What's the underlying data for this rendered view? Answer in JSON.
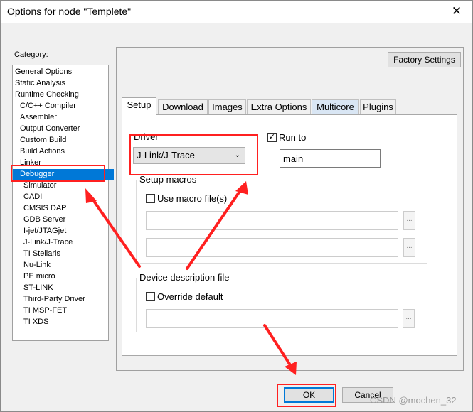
{
  "window": {
    "title": "Options for node \"Templete\"",
    "close_glyph": "✕"
  },
  "category": {
    "label": "Category:",
    "items": [
      {
        "label": "General Options",
        "indent": 0
      },
      {
        "label": "Static Analysis",
        "indent": 0
      },
      {
        "label": "Runtime Checking",
        "indent": 0
      },
      {
        "label": "C/C++ Compiler",
        "indent": 1
      },
      {
        "label": "Assembler",
        "indent": 1
      },
      {
        "label": "Output Converter",
        "indent": 1
      },
      {
        "label": "Custom Build",
        "indent": 1
      },
      {
        "label": "Build Actions",
        "indent": 1
      },
      {
        "label": "Linker",
        "indent": 1
      },
      {
        "label": "Debugger",
        "indent": 1,
        "selected": true
      },
      {
        "label": "Simulator",
        "indent": 2
      },
      {
        "label": "CADI",
        "indent": 2
      },
      {
        "label": "CMSIS DAP",
        "indent": 2
      },
      {
        "label": "GDB Server",
        "indent": 2
      },
      {
        "label": "I-jet/JTAGjet",
        "indent": 2
      },
      {
        "label": "J-Link/J-Trace",
        "indent": 2
      },
      {
        "label": "TI Stellaris",
        "indent": 2
      },
      {
        "label": "Nu-Link",
        "indent": 2
      },
      {
        "label": "PE micro",
        "indent": 2
      },
      {
        "label": "ST-LINK",
        "indent": 2
      },
      {
        "label": "Third-Party Driver",
        "indent": 2
      },
      {
        "label": "TI MSP-FET",
        "indent": 2
      },
      {
        "label": "TI XDS",
        "indent": 2
      }
    ]
  },
  "factory_settings_label": "Factory Settings",
  "tabs": [
    "Setup",
    "Download",
    "Images",
    "Extra Options",
    "Multicore",
    "Plugins"
  ],
  "setup": {
    "driver_label": "Driver",
    "driver_value": "J-Link/J-Trace",
    "run_to_label": "Run to",
    "run_to_checked": true,
    "run_to_value": "main",
    "macros_title": "Setup macros",
    "use_macro_label": "Use macro file(s)",
    "device_desc_title": "Device description file",
    "override_label": "Override default",
    "browse_glyph": "..."
  },
  "footer": {
    "ok_label": "OK",
    "cancel_label": "Cancel"
  },
  "watermark": "CSDN @mochen_32",
  "annotation_color": "#ff2020",
  "check_glyph": "✓"
}
